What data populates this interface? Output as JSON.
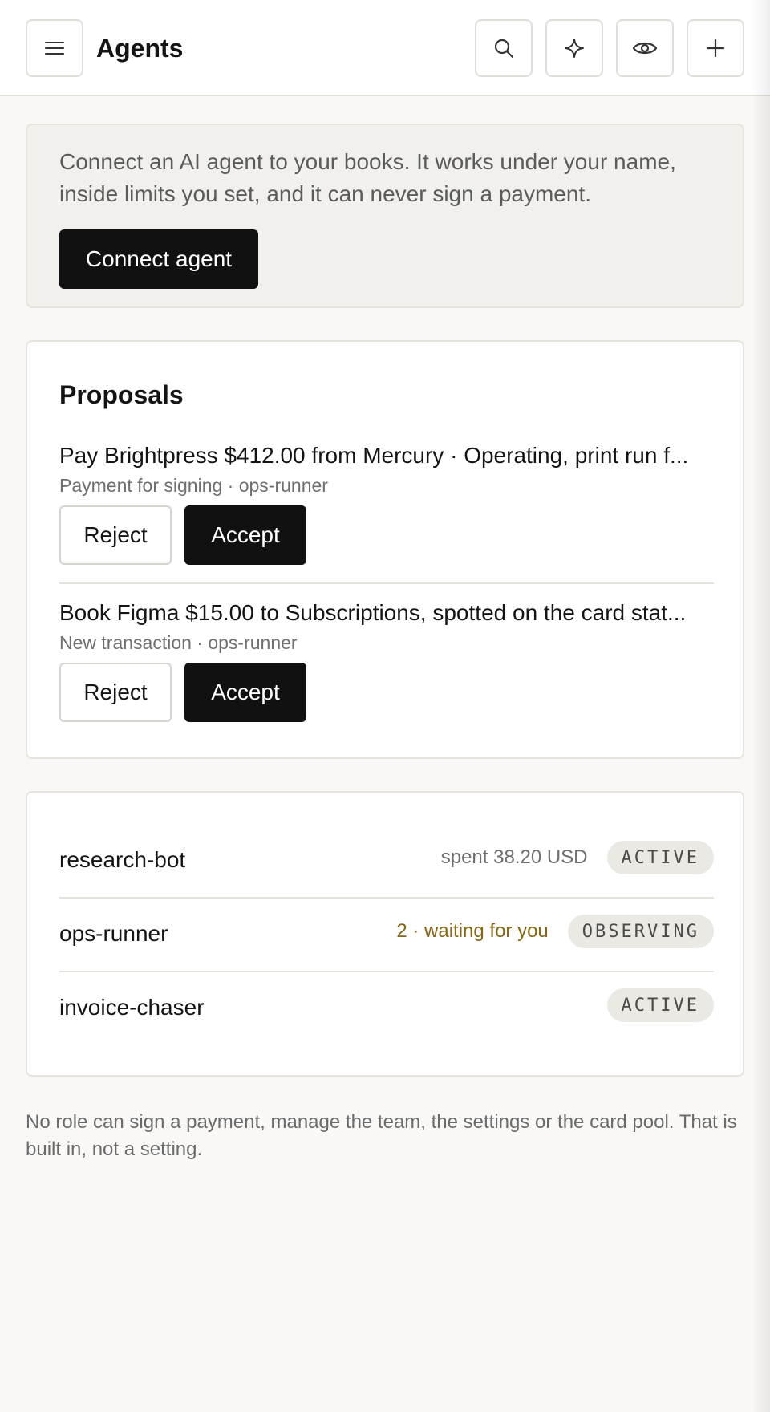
{
  "header": {
    "title": "Agents",
    "icons": {
      "menu": "menu-icon",
      "search": "search-icon",
      "sparkle": "sparkle-icon",
      "observe": "eye-icon",
      "add": "plus-icon"
    }
  },
  "intro": {
    "text": "Connect an AI agent to your books. It works under your name, inside limits you set, and it can never sign a payment.",
    "connect_label": "Connect agent"
  },
  "proposals": {
    "title": "Proposals",
    "items": [
      {
        "title": "Pay Brightpress $412.00 from Mercury · Operating, print run f...",
        "meta": "Payment for signing · ops-runner",
        "reject_label": "Reject",
        "accept_label": "Accept"
      },
      {
        "title": "Book Figma $15.00 to Subscriptions, spotted on the card stat...",
        "meta": "New transaction · ops-runner",
        "reject_label": "Reject",
        "accept_label": "Accept"
      }
    ]
  },
  "agents": [
    {
      "name": "research-bot",
      "meta": "spent 38.20 USD",
      "status": "ACTIVE"
    },
    {
      "name": "ops-runner",
      "meta": "2 · waiting for you",
      "status": "OBSERVING"
    },
    {
      "name": "invoice-chaser",
      "meta": "",
      "status": "ACTIVE"
    }
  ],
  "footnote": "No role can sign a payment, manage the team, the settings or the card pool. That is built in, not a setting.",
  "colors": {
    "background": "#f9f8f6",
    "primary_button": "#111111",
    "waiting_text": "#8a6612",
    "badge_bg": "#ebe9e3"
  }
}
